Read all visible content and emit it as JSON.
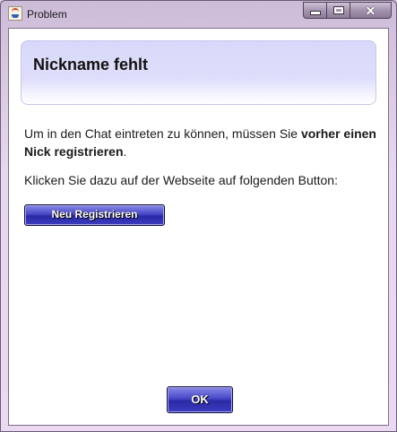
{
  "window": {
    "title": "Problem",
    "icon": "java-cup-icon",
    "controls": [
      "minimize-icon",
      "maximize-icon",
      "close-icon"
    ]
  },
  "header": {
    "title": "Nickname fehlt"
  },
  "message": {
    "line1_prefix": "Um in den Chat eintreten zu können, müssen Sie ",
    "line1_bold": "vorher einen Nick registrieren",
    "line1_suffix": ".",
    "line2": "Klicken Sie dazu auf der Webseite auf folgenden Button:"
  },
  "buttons": {
    "register_label": "Neu Registrieren",
    "ok_label": "OK"
  },
  "colors": {
    "header_bg": "#dcdcfa",
    "button_bg": "#3a3ab8",
    "window_frame": "#d9c8e2"
  }
}
